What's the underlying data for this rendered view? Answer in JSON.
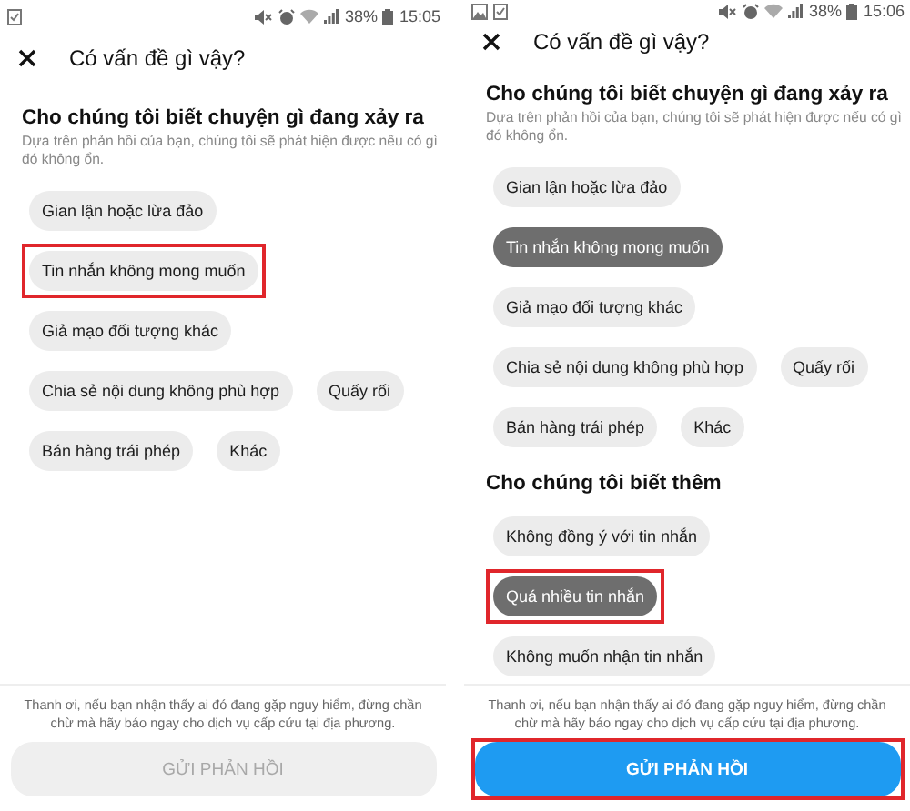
{
  "panels": [
    {
      "status_bar": {
        "notification_icons": [
          {
            "kind": "checklist"
          }
        ],
        "battery": "38%",
        "time": "15:05"
      },
      "header": {
        "title": "Có vấn đề gì vậy?"
      },
      "sections": [
        {
          "heading": "Cho chúng tôi biết chuyện gì đang xảy ra",
          "subtitle": "Dựa trên phản hồi của bạn, chúng tôi sẽ phát hiện được nếu có gì đó không ổn.",
          "chips": [
            {
              "label": "Gian lận hoặc lừa đảo",
              "selected": false,
              "highlighted": false
            },
            {
              "label": "Tin nhắn không mong muốn",
              "selected": false,
              "highlighted": true
            },
            {
              "label": "Giả mạo đối tượng khác",
              "selected": false,
              "highlighted": false
            },
            {
              "label": "Chia sẻ nội dung không phù hợp",
              "selected": false,
              "highlighted": false
            },
            {
              "label": "Quấy rối",
              "selected": false,
              "highlighted": false
            },
            {
              "label": "Bán hàng trái phép",
              "selected": false,
              "highlighted": false
            },
            {
              "label": "Khác",
              "selected": false,
              "highlighted": false
            }
          ]
        }
      ],
      "footer": {
        "notice": "Thanh ơi, nếu bạn nhận thấy ai đó đang gặp nguy hiểm, đừng chần chừ mà hãy báo ngay cho dịch vụ cấp cứu tại địa phương.",
        "button": {
          "label": "GỬI PHẢN HỒI",
          "disabled": true,
          "highlighted": false
        }
      }
    },
    {
      "status_bar": {
        "notification_icons": [
          {
            "kind": "image"
          },
          {
            "kind": "checklist"
          }
        ],
        "battery": "38%",
        "time": "15:06"
      },
      "header": {
        "title": "Có vấn đề gì vậy?"
      },
      "sections": [
        {
          "heading": "Cho chúng tôi biết chuyện gì đang xảy ra",
          "subtitle": "Dựa trên phản hồi của bạn, chúng tôi sẽ phát hiện được nếu có gì đó không ổn.",
          "chips": [
            {
              "label": "Gian lận hoặc lừa đảo",
              "selected": false,
              "highlighted": false
            },
            {
              "label": "Tin nhắn không mong muốn",
              "selected": true,
              "highlighted": false
            },
            {
              "label": "Giả mạo đối tượng khác",
              "selected": false,
              "highlighted": false
            },
            {
              "label": "Chia sẻ nội dung không phù hợp",
              "selected": false,
              "highlighted": false
            },
            {
              "label": "Quấy rối",
              "selected": false,
              "highlighted": false
            },
            {
              "label": "Bán hàng trái phép",
              "selected": false,
              "highlighted": false
            },
            {
              "label": "Khác",
              "selected": false,
              "highlighted": false
            }
          ]
        },
        {
          "heading": "Cho chúng tôi biết thêm",
          "chips": [
            {
              "label": "Không đồng ý với tin nhắn",
              "selected": false,
              "highlighted": false
            },
            {
              "label": "Quá nhiều tin nhắn",
              "selected": true,
              "highlighted": true
            },
            {
              "label": "Không muốn nhận tin nhắn",
              "selected": false,
              "highlighted": false
            }
          ]
        }
      ],
      "footer": {
        "notice": "Thanh ơi, nếu bạn nhận thấy ai đó đang gặp nguy hiểm, đừng chần chừ mà hãy báo ngay cho dịch vụ cấp cứu tại địa phương.",
        "button": {
          "label": "GỬI PHẢN HỒI",
          "disabled": false,
          "highlighted": true
        }
      }
    }
  ]
}
